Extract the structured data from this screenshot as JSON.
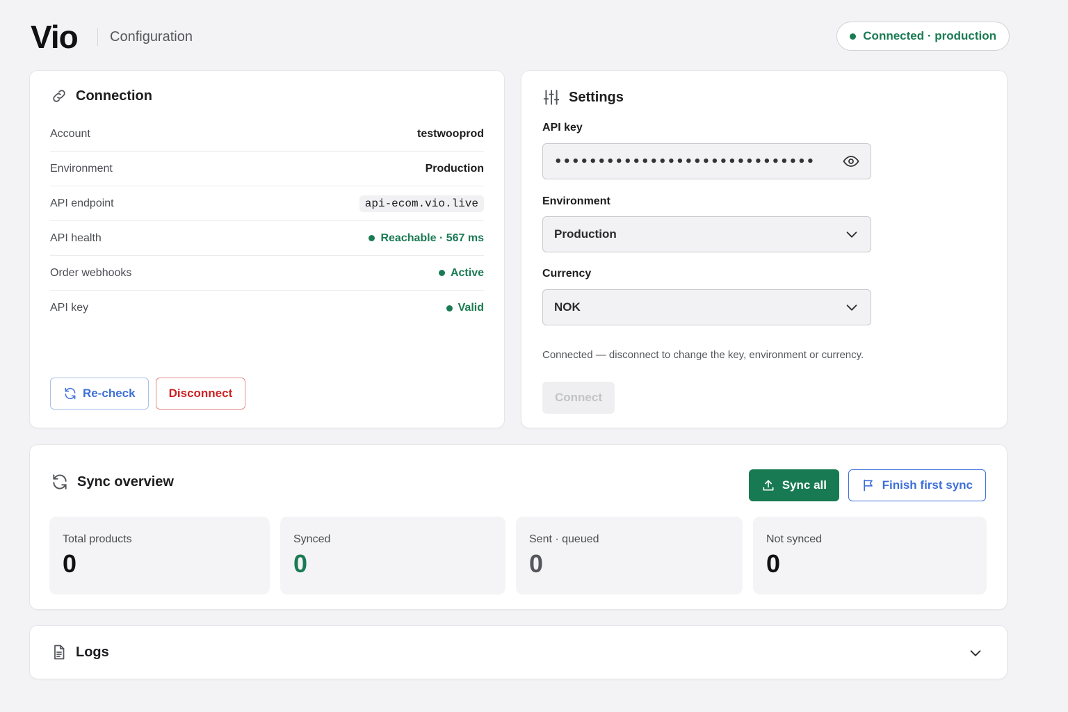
{
  "header": {
    "logo": "Vio",
    "subtitle": "Configuration",
    "status": "Connected · production"
  },
  "connection": {
    "title": "Connection",
    "rows": [
      {
        "label": "Account",
        "value": "testwooprod"
      },
      {
        "label": "Environment",
        "value": "Production"
      },
      {
        "label": "API endpoint",
        "value": "api-ecom.vio.live"
      },
      {
        "label": "API health",
        "value": "Reachable · 567 ms"
      },
      {
        "label": "Order webhooks",
        "value": "Active"
      },
      {
        "label": "API key",
        "value": "Valid"
      }
    ],
    "recheck_label": "Re-check",
    "disconnect_label": "Disconnect"
  },
  "settings": {
    "title": "Settings",
    "api_key_label": "API key",
    "api_key_value": "••••••••••••••••••••••••••••••",
    "environment_label": "Environment",
    "environment_value": "Production",
    "currency_label": "Currency",
    "currency_value": "NOK",
    "help": "Connected — disconnect to change the key, environment or currency.",
    "connect_label": "Connect"
  },
  "sync": {
    "title": "Sync overview",
    "sync_all_label": "Sync all",
    "finish_label": "Finish first sync",
    "stats": [
      {
        "label": "Total products",
        "value": "0",
        "color": "#111111"
      },
      {
        "label": "Synced",
        "value": "0",
        "color": "#1a7b53"
      },
      {
        "label": "Sent · queued",
        "value": "0",
        "color": "#55575c"
      },
      {
        "label": "Not synced",
        "value": "0",
        "color": "#111111"
      }
    ]
  },
  "logs": {
    "title": "Logs"
  },
  "colors": {
    "accent_green": "#177a52",
    "status_green": "#1a7b53",
    "link_blue": "#3d6fd9",
    "danger_red": "#cc2222"
  }
}
